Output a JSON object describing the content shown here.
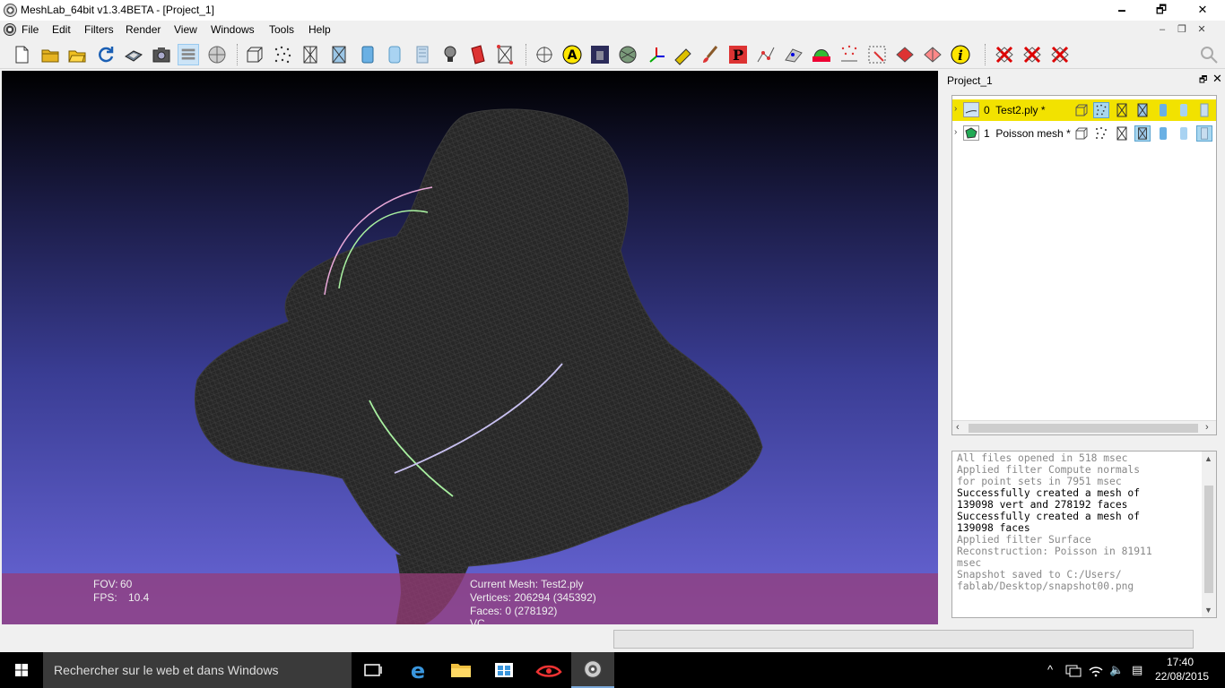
{
  "window": {
    "title": "MeshLab_64bit v1.3.4BETA - [Project_1]",
    "minimize_glyph": "🗕",
    "maximize_glyph": "🗗",
    "close_glyph": "✕"
  },
  "menubar": {
    "items": [
      "File",
      "Edit",
      "Filters",
      "Render",
      "View",
      "Windows",
      "Tools",
      "Help"
    ],
    "mdi_minimize_glyph": "–",
    "mdi_restore_glyph": "❐",
    "mdi_close_glyph": "✕"
  },
  "toolbar": {
    "buttons": [
      "new-project",
      "open-project",
      "open-file",
      "reload",
      "save",
      "snapshot",
      "layers",
      "view-from-layers",
      "bounding-box",
      "points",
      "wireframe",
      "hidden-lines",
      "flat",
      "smooth",
      "texture",
      "light",
      "back-face",
      "color-per-vertex",
      "align",
      "annotate",
      "reference",
      "measure",
      "direction",
      "paint",
      "pickpoints",
      "select-vertices",
      "select-faces",
      "select-connected",
      "info",
      "delete-vertices",
      "delete-faces",
      "delete-all"
    ],
    "active": [
      "layers"
    ]
  },
  "viewport": {
    "fov_label": "FOV:",
    "fov_value": "60",
    "fps_label": "FPS:",
    "fps_value": "10.4",
    "current_mesh": "Current Mesh: Test2.ply",
    "vertices": "Vertices: 206294 (345392)",
    "faces": "Faces: 0 (278192)",
    "vc": "VC"
  },
  "layer_panel": {
    "title": "Project_1",
    "float_glyph": "🗗",
    "close_glyph": "✕",
    "layers": [
      {
        "index": "0",
        "name": "Test2.ply *",
        "selected": true
      },
      {
        "index": "1",
        "name": "Poisson mesh *",
        "selected": false
      }
    ],
    "expand_glyph": "›",
    "scroll_left": "‹",
    "scroll_right": "›"
  },
  "log": {
    "lines": [
      {
        "text": "All files opened in 518 msec",
        "style": "gray"
      },
      {
        "text": "Applied filter Compute normals",
        "style": "gray"
      },
      {
        "text": "for point sets in 7951 msec",
        "style": "gray"
      },
      {
        "text": "Successfully created a mesh of",
        "style": "black"
      },
      {
        "text": "139098 vert and 278192 faces",
        "style": "black"
      },
      {
        "text": "Successfully created a mesh of",
        "style": "black"
      },
      {
        "text": "139098 faces",
        "style": "black"
      },
      {
        "text": "Applied filter Surface",
        "style": "gray"
      },
      {
        "text": "Reconstruction: Poisson in 81911",
        "style": "gray"
      },
      {
        "text": "msec",
        "style": "gray"
      },
      {
        "text": "Snapshot saved to C:/Users/",
        "style": "gray"
      },
      {
        "text": "fablab/Desktop/snapshot00.png",
        "style": "gray"
      }
    ],
    "scroll_up": "▲",
    "scroll_down": "▼"
  },
  "taskbar": {
    "search_placeholder": "Rechercher sur le web et dans Windows",
    "time": "17:40",
    "date": "22/08/2015",
    "tray": {
      "chevron_glyph": "^",
      "speaker_glyph": "🔈",
      "notification_glyph": "▤"
    }
  },
  "colors": {
    "selected_layer": "#f2e200",
    "info_overlay": "#963c78",
    "viewport_bottom": "#6a67d9"
  }
}
